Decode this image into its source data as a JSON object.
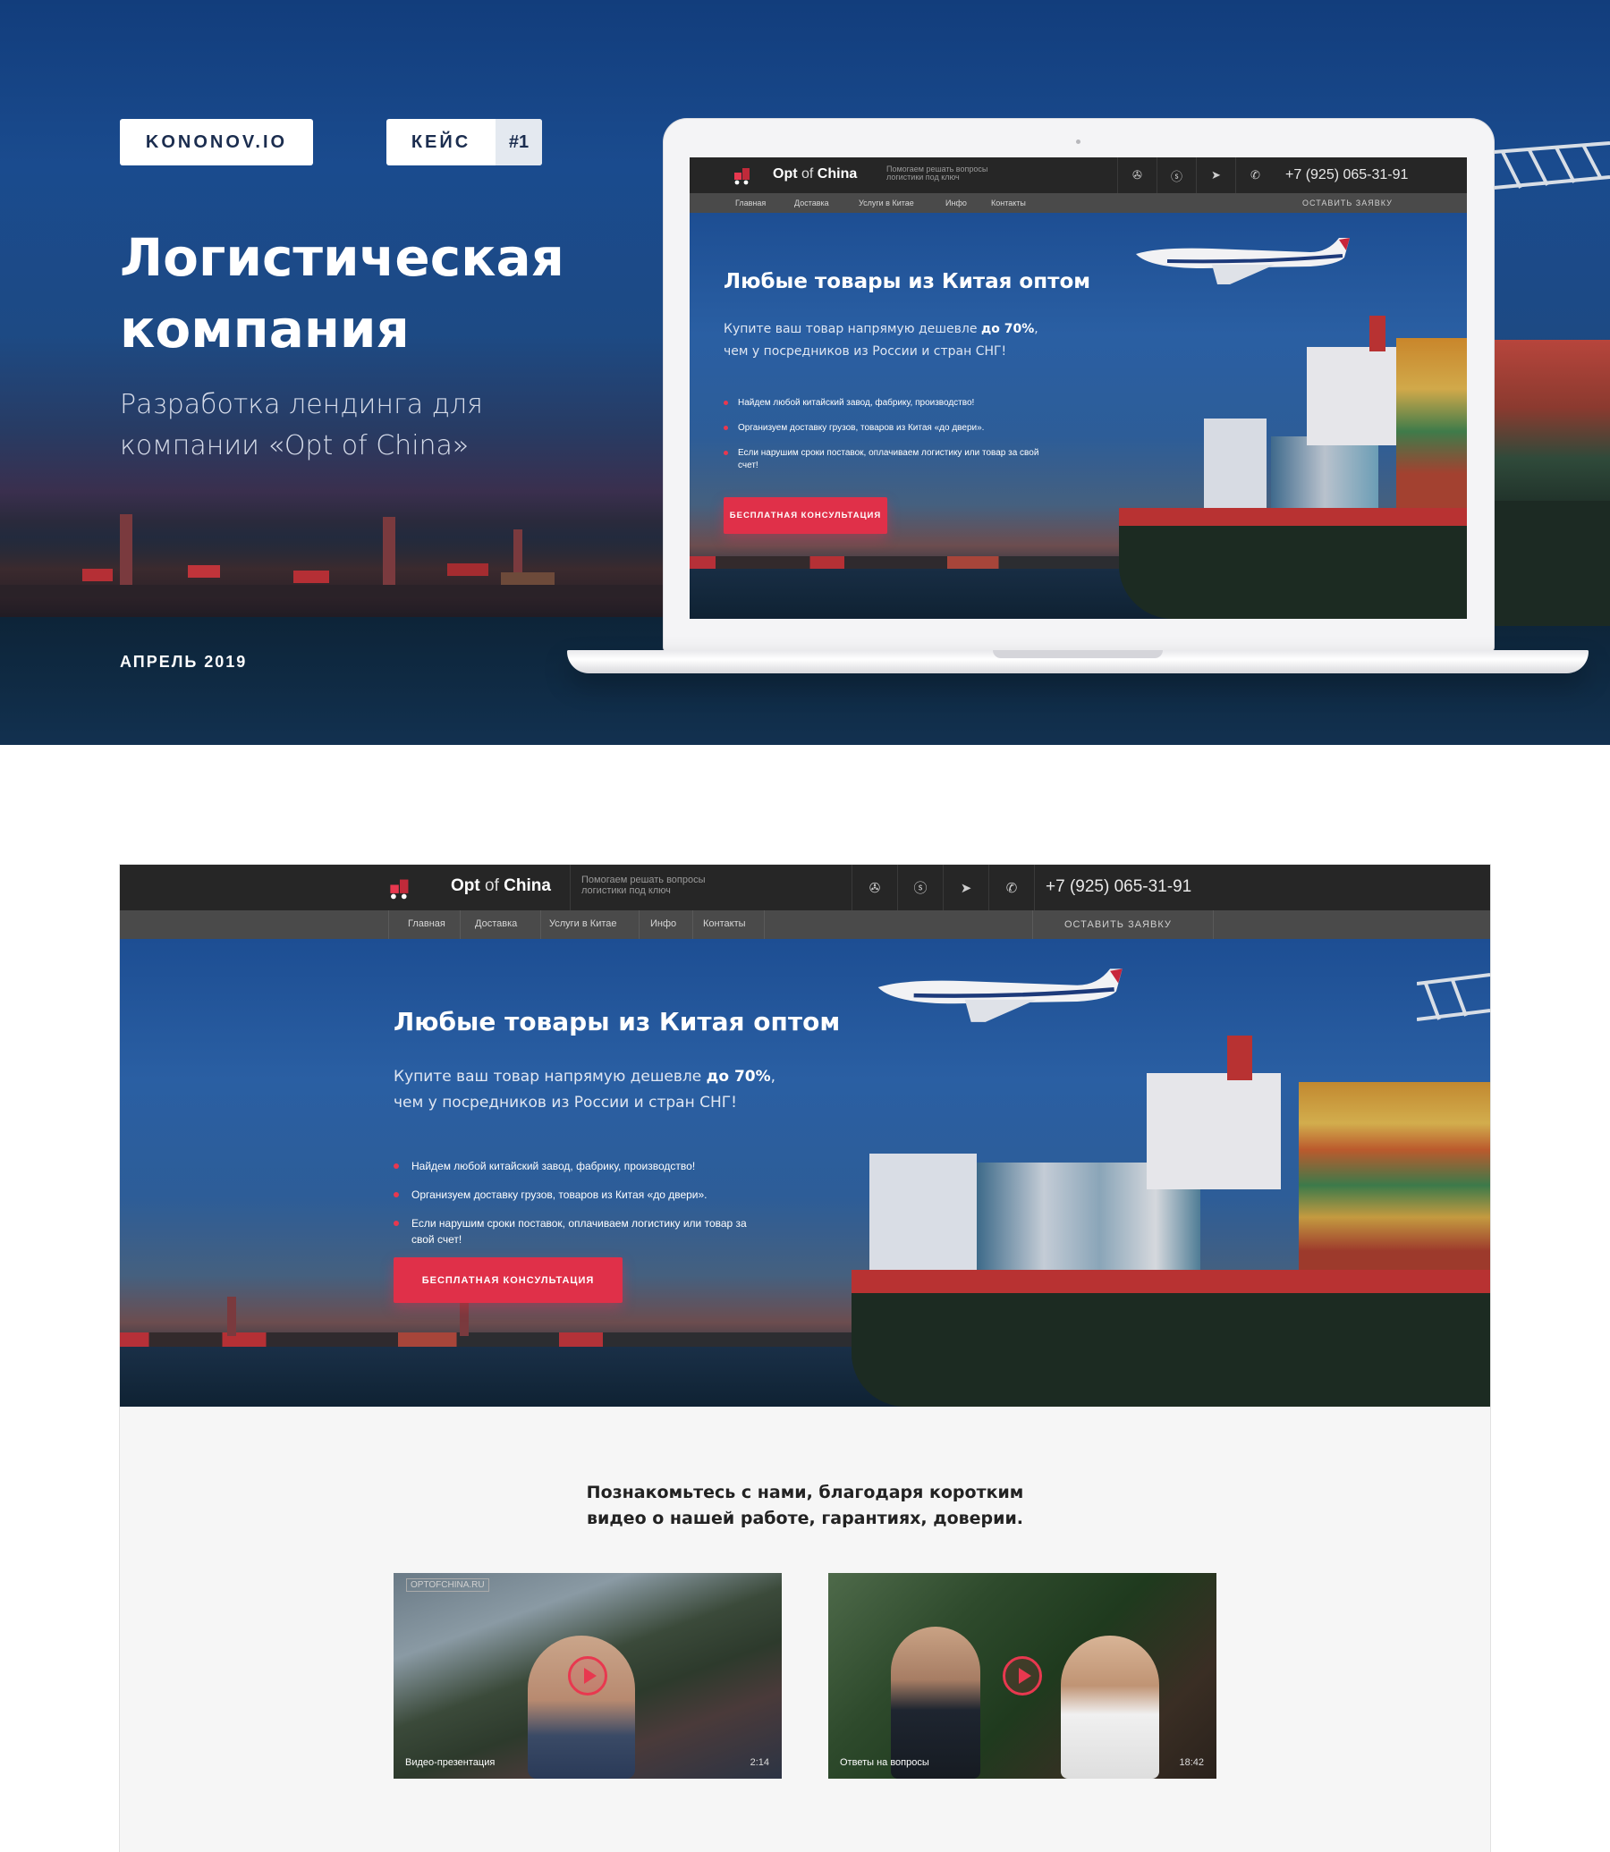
{
  "hero": {
    "badge_logo": "KONONOV.IO",
    "badge_case": "КЕЙС",
    "badge_case_num": "#1",
    "title_line1": "Логистическая",
    "title_line2": "компания",
    "subtitle_line1": "Разработка лендинга для",
    "subtitle_line2": "компании «Opt of China»",
    "date": "АПРЕЛЬ 2019"
  },
  "site": {
    "brand_main": "Opt",
    "brand_of": "of",
    "brand_china": "China",
    "tagline_line1": "Помогаем решать вопросы",
    "tagline_line2": "логистики под ключ",
    "icons": [
      "wechat-icon",
      "skype-icon",
      "telegram-icon",
      "whatsapp-icon"
    ],
    "phone": "+7 (925) 065-31-91",
    "nav": [
      "Главная",
      "Доставка",
      "Услуги в Китае",
      "Инфо",
      "Контакты"
    ],
    "order": "ОСТАВИТЬ ЗАЯВКУ",
    "headline": "Любые товары из Китая оптом",
    "lead_line1_pre": "Купите ваш товар напрямую дешевле ",
    "lead_line1_bold": "до 70%",
    "lead_line1_post": ",",
    "lead_line2": "чем у посредников из России и стран СНГ!",
    "bullets": [
      "Найдем любой китайский завод, фабрику, производство!",
      "Организуем доставку грузов, товаров из Китая «до двери».",
      "Если нарушим сроки поставок, оплачиваем логистику или товар за свой счет!"
    ],
    "cta": "БЕСПЛАТНАЯ КОНСУЛЬТАЦИЯ",
    "intro_line1": "Познакомьтесь с нами, благодаря  коротким",
    "intro_line2": "видео о нашей работе, гарантиях, доверии.",
    "videos": [
      {
        "caption": "Видео-презентация",
        "duration": "2:14",
        "watermark": "OPTOFCHINA.RU"
      },
      {
        "caption": "Ответы на вопросы",
        "duration": "18:42"
      }
    ]
  },
  "colors": {
    "accent": "#e03049",
    "badge_text": "#1b2d4f",
    "topbar": "#262626",
    "navbar": "#4a4a4a"
  }
}
